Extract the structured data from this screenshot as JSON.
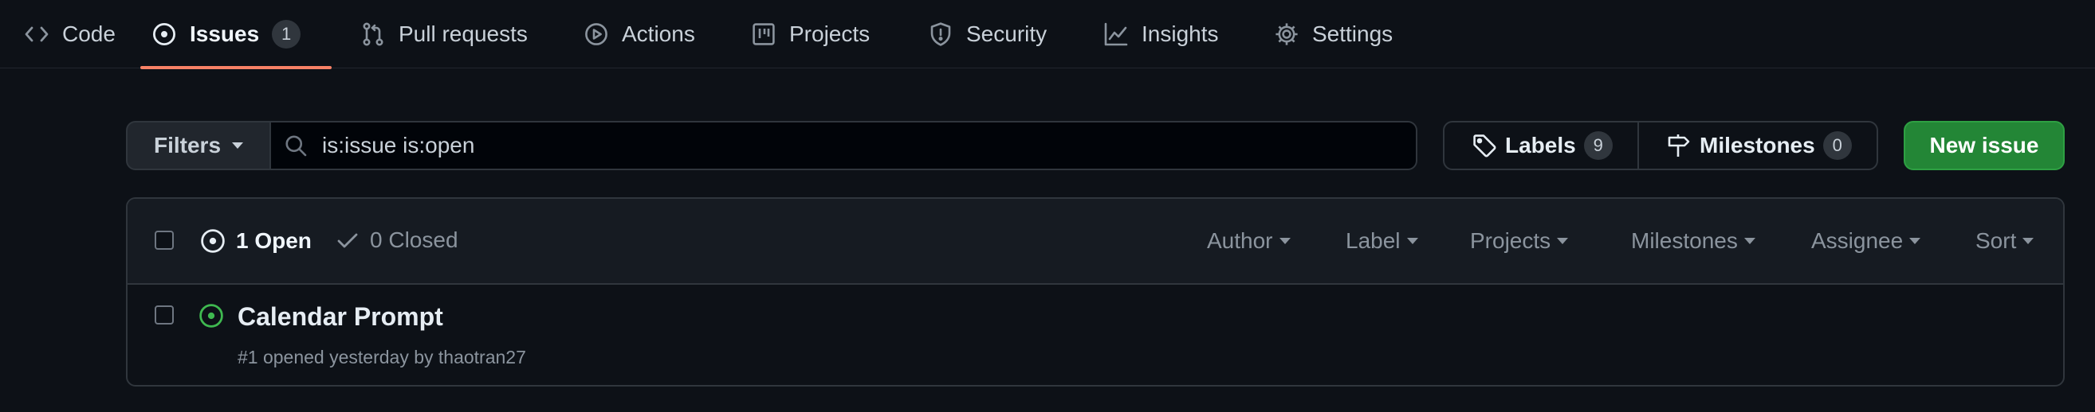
{
  "tabs": [
    {
      "label": "Code",
      "icon": "code-icon"
    },
    {
      "label": "Issues",
      "icon": "issue-opened-icon",
      "count": "1",
      "active": true
    },
    {
      "label": "Pull requests",
      "icon": "git-pull-request-icon"
    },
    {
      "label": "Actions",
      "icon": "play-icon"
    },
    {
      "label": "Projects",
      "icon": "table-icon"
    },
    {
      "label": "Security",
      "icon": "shield-icon"
    },
    {
      "label": "Insights",
      "icon": "graph-icon"
    },
    {
      "label": "Settings",
      "icon": "gear-icon"
    }
  ],
  "toolbar": {
    "filters_label": "Filters",
    "search_value": "is:issue is:open",
    "labels_label": "Labels",
    "labels_count": "9",
    "milestones_label": "Milestones",
    "milestones_count": "0",
    "new_issue_label": "New issue"
  },
  "list_header": {
    "open_label": "1 Open",
    "closed_label": "0 Closed",
    "filters": [
      "Author",
      "Label",
      "Projects",
      "Milestones",
      "Assignee",
      "Sort"
    ]
  },
  "issues": [
    {
      "title": "Calendar Prompt",
      "meta": "#1 opened yesterday by thaotran27"
    }
  ],
  "colors": {
    "background": "#0d1117",
    "active_tab_underline": "#f78166",
    "new_issue_button": "#238636",
    "open_issue_icon": "#3fb950"
  }
}
